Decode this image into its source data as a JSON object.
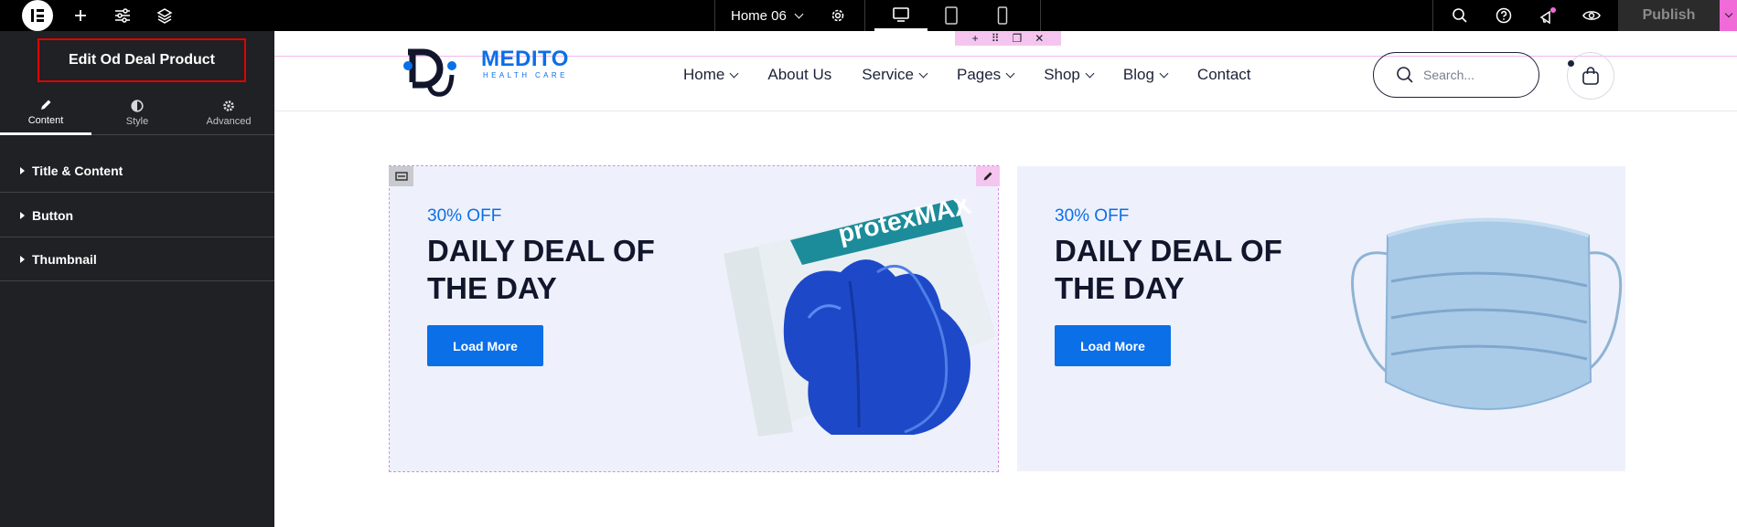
{
  "topbar": {
    "page_name": "Home 06",
    "publish_label": "Publish",
    "icons": [
      "elementor-logo-icon",
      "add-icon",
      "settings-sliders-icon",
      "layers-icon",
      "gear-icon",
      "desktop-icon",
      "tablet-icon",
      "mobile-icon",
      "search-icon",
      "help-icon",
      "whats-new-icon",
      "preview-eye-icon",
      "chevron-down-icon"
    ]
  },
  "panel": {
    "title": "Edit Od Deal Product",
    "tabs": [
      {
        "label": "Content",
        "icon": "pencil-icon",
        "active": true
      },
      {
        "label": "Style",
        "icon": "half-circle-icon",
        "active": false
      },
      {
        "label": "Advanced",
        "icon": "gear-icon",
        "active": false
      }
    ],
    "sections": [
      {
        "label": "Title & Content"
      },
      {
        "label": "Button"
      },
      {
        "label": "Thumbnail"
      }
    ]
  },
  "site": {
    "logo_name": "MEDITO",
    "logo_tagline": "HEALTH CARE",
    "nav": [
      {
        "label": "Home",
        "dropdown": true
      },
      {
        "label": "About Us",
        "dropdown": false
      },
      {
        "label": "Service",
        "dropdown": true
      },
      {
        "label": "Pages",
        "dropdown": true
      },
      {
        "label": "Shop",
        "dropdown": true
      },
      {
        "label": "Blog",
        "dropdown": true
      },
      {
        "label": "Contact",
        "dropdown": false
      }
    ],
    "search_placeholder": "Search..."
  },
  "deals": [
    {
      "discount": "30% OFF",
      "title": "DAILY DEAL OF THE DAY",
      "button": "Load More",
      "image": "blue-nitrile-gloves",
      "box_brand": "protexMAX"
    },
    {
      "discount": "30% OFF",
      "title": "DAILY DEAL OF THE DAY",
      "button": "Load More",
      "image": "surgical-face-mask"
    }
  ],
  "colors": {
    "accent": "#0b6fe8",
    "dark_text": "#11162c",
    "card_bg": "#eef1fb",
    "selection": "#f06ad8",
    "highlight_box": "#e00000"
  }
}
